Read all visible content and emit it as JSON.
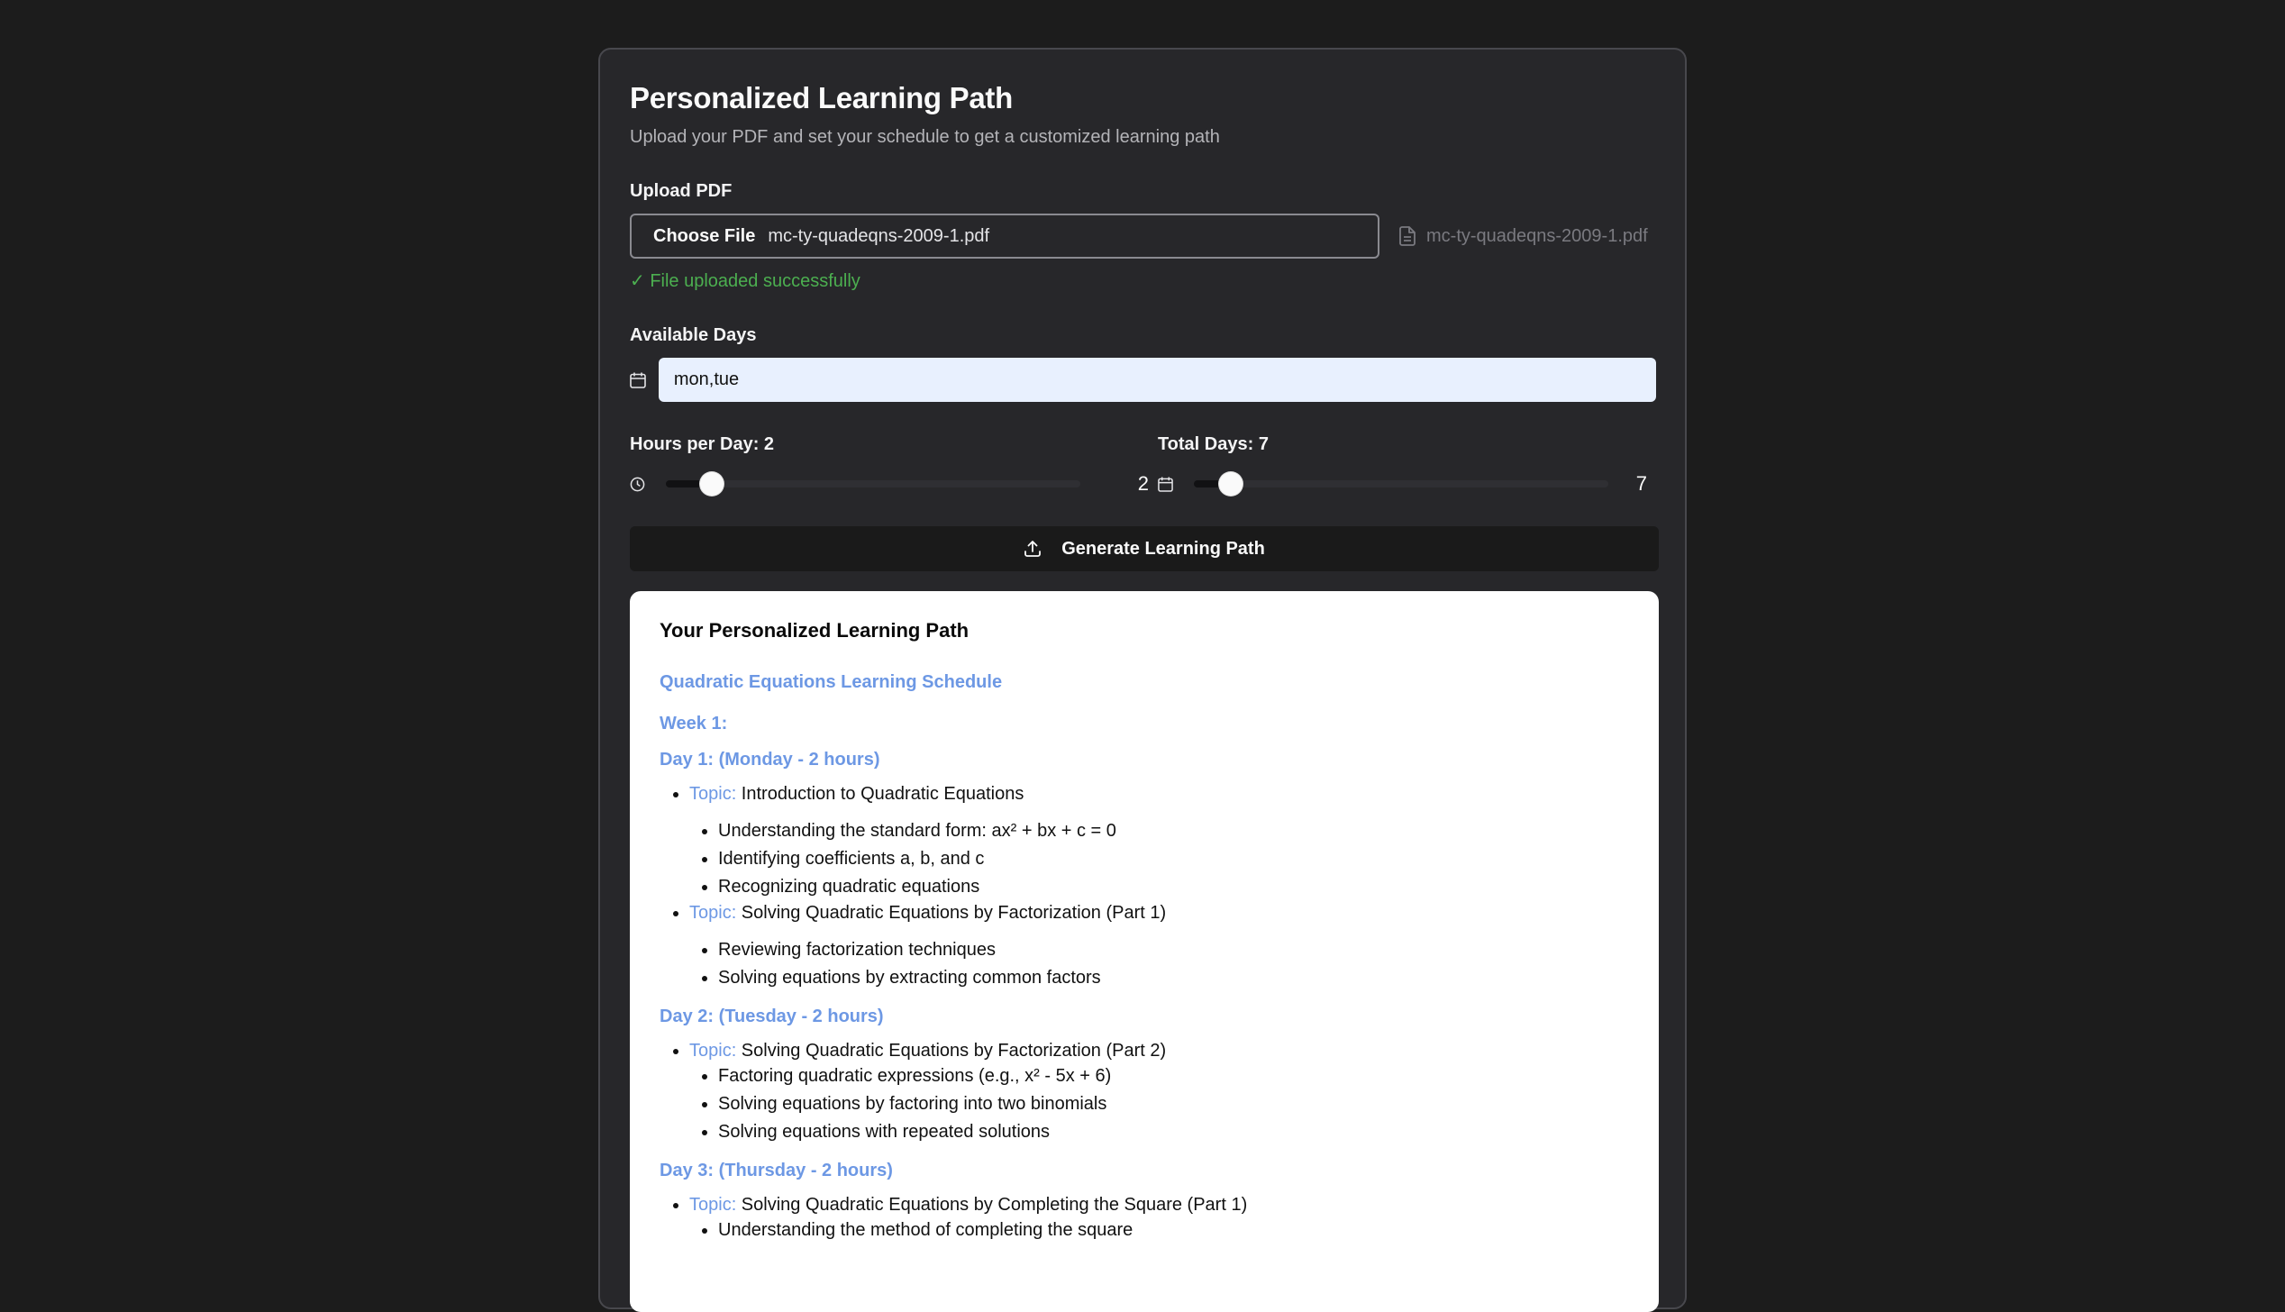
{
  "card": {
    "title": "Personalized Learning Path",
    "subtitle": "Upload your PDF and set your schedule to get a customized learning path"
  },
  "upload": {
    "label": "Upload PDF",
    "choose_button": "Choose File",
    "file_name": "mc-ty-quadeqns-2009-1.pdf",
    "side_file_name": "mc-ty-quadeqns-2009-1.pdf",
    "success_message": "✓ File uploaded successfully"
  },
  "days": {
    "label": "Available Days",
    "value": "mon,tue"
  },
  "hours_slider": {
    "label": "Hours per Day: 2",
    "value": "2",
    "level": 0.11
  },
  "total_slider": {
    "label": "Total Days: 7",
    "value": "7",
    "level": 0.09
  },
  "generate_button": {
    "label": "Generate Learning Path"
  },
  "result": {
    "title": "Your Personalized Learning Path",
    "schedule_title": "Quadratic Equations Learning Schedule",
    "week1": "Week 1:",
    "topic_label": "Topic:",
    "day1": {
      "heading": "Day 1: (Monday - 2 hours)",
      "topic1": " Introduction to Quadratic Equations",
      "topic1_items": [
        "Understanding the standard form: ax² + bx + c = 0",
        "Identifying coefficients a, b, and c",
        "Recognizing quadratic equations"
      ],
      "topic2": " Solving Quadratic Equations by Factorization (Part 1)",
      "topic2_items": [
        "Reviewing factorization techniques",
        "Solving equations by extracting common factors"
      ]
    },
    "day2": {
      "heading": "Day 2: (Tuesday - 2 hours)",
      "topic1": " Solving Quadratic Equations by Factorization (Part 2)",
      "topic1_items": [
        "Factoring quadratic expressions (e.g., x² - 5x + 6)",
        "Solving equations by factoring into two binomials",
        "Solving equations with repeated solutions"
      ]
    },
    "day3": {
      "heading": "Day 3: (Thursday - 2 hours)",
      "topic1": " Solving Quadratic Equations by Completing the Square (Part 1)",
      "topic1_items": [
        "Understanding the method of completing the square"
      ]
    }
  },
  "icons": {
    "file": "file-icon",
    "calendar": "calendar-icon",
    "clock": "clock-icon",
    "upload": "upload-icon"
  }
}
